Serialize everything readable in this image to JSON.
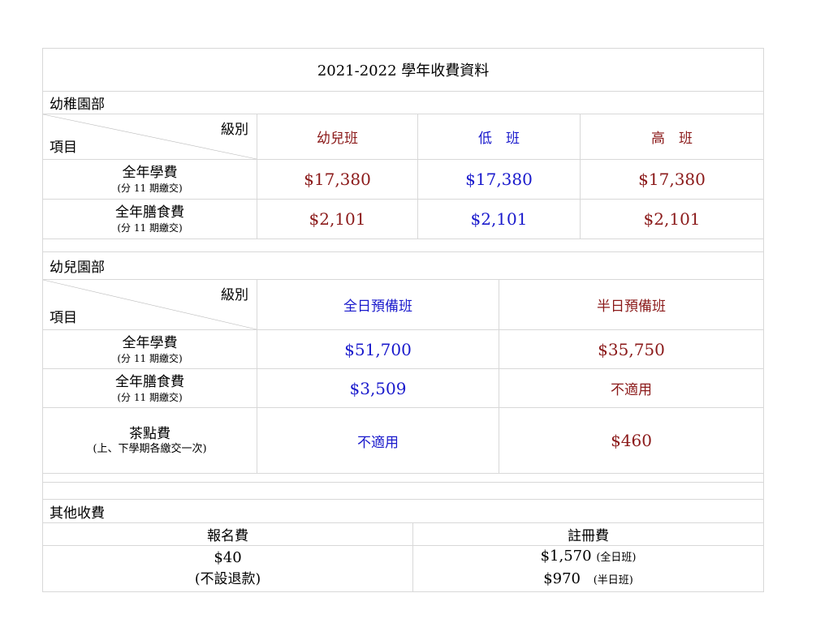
{
  "title": "2021-2022 學年收費資料",
  "kindergarten": {
    "section_label": "幼稚園部",
    "header_corner_top": "級別",
    "header_corner_bottom": "項目",
    "classes": [
      "幼兒班",
      "低　班",
      "高　班"
    ],
    "rows": [
      {
        "name": "全年學費",
        "note": "(分 11 期繳交)",
        "values": [
          "$17,380",
          "$17,380",
          "$17,380"
        ]
      },
      {
        "name": "全年膳食費",
        "note": "(分 11 期繳交)",
        "values": [
          "$2,101",
          "$2,101",
          "$2,101"
        ]
      }
    ]
  },
  "nursery": {
    "section_label": "幼兒園部",
    "header_corner_top": "級別",
    "header_corner_bottom": "項目",
    "classes": [
      "全日預備班",
      "半日預備班"
    ],
    "rows": [
      {
        "name": "全年學費",
        "note": "(分 11 期繳交)",
        "values": [
          "$51,700",
          "$35,750"
        ]
      },
      {
        "name": "全年膳食費",
        "note": "(分 11 期繳交)",
        "values": [
          "$3,509",
          "不適用"
        ]
      },
      {
        "name": "茶點費",
        "note": "(上、下學期各繳交一次)",
        "values": [
          "不適用",
          "$460"
        ]
      }
    ]
  },
  "other": {
    "section_label": "其他收費",
    "headers": [
      "報名費",
      "註冊費"
    ],
    "application_fee": {
      "amount": "$40",
      "note": "(不設退款)"
    },
    "registration_fee": [
      {
        "amount": "$1,570",
        "note": "(全日班)"
      },
      {
        "amount": "$970",
        "note": "(半日班)"
      }
    ]
  },
  "colors": {
    "red": "#8b1a1a",
    "blue": "#1a1acc",
    "border": "#d8d8d8"
  }
}
